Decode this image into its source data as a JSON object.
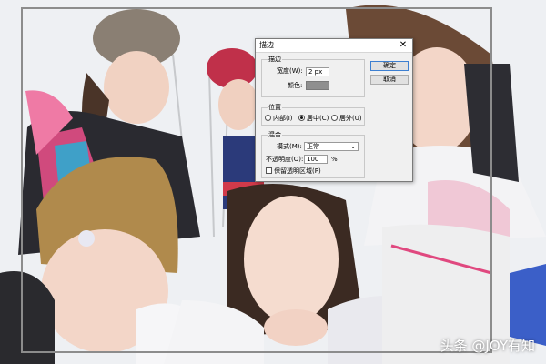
{
  "dialog": {
    "title": "描边",
    "close_glyph": "✕",
    "stroke": {
      "legend": "描边",
      "width_label": "宽度(W):",
      "width_value": "2 px",
      "color_label": "颜色:",
      "color_value": "#8f8f8f"
    },
    "position": {
      "legend": "位置",
      "options": [
        "内部(I)",
        "居中(C)",
        "居外(U)"
      ],
      "selected": "居中(C)"
    },
    "blend": {
      "legend": "混合",
      "mode_label": "模式(M):",
      "mode_value": "正常",
      "opacity_label": "不透明度(O):",
      "opacity_value": "100",
      "opacity_unit": "%",
      "preserve_label": "保留透明区域(P)",
      "preserve_checked": false
    },
    "ok_label": "确定",
    "cancel_label": "取消"
  },
  "watermark": "头条 @JOY有知",
  "colors": {
    "dialog_bg": "#f0f0f0",
    "accent_border": "#3c7fd1",
    "selection": "#8c8c8c"
  }
}
